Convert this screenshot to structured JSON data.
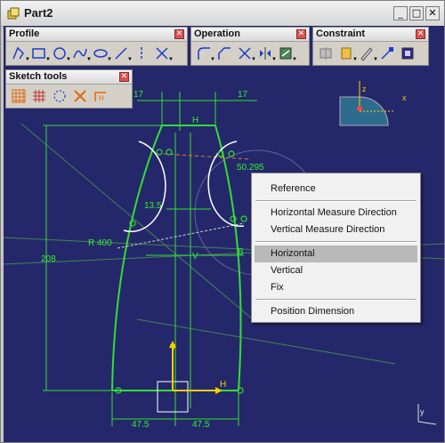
{
  "window": {
    "title": "Part2"
  },
  "toolbars": {
    "profile": {
      "title": "Profile"
    },
    "operation": {
      "title": "Operation"
    },
    "constraint": {
      "title": "Constraint"
    },
    "sketch_tools": {
      "title": "Sketch tools"
    }
  },
  "compass": {
    "axis_z": "z",
    "axis_x": "x"
  },
  "sketch": {
    "dimensions": {
      "top_left_width": "17",
      "top_right_width": "17",
      "top_label": "H",
      "angle": "50.295",
      "middle_width": "13.5",
      "radius": "R 400",
      "height": "208",
      "midline_label": "V",
      "right_label": "B",
      "bottom_left": "47.5",
      "bottom_right": "47.5"
    },
    "axis_v": "V",
    "axis_h": "H"
  },
  "context_menu": {
    "items": {
      "reference": "Reference",
      "horizontal_measure": "Horizontal Measure Direction",
      "vertical_measure": "Vertical Measure Direction",
      "horizontal": "Horizontal",
      "vertical": "Vertical",
      "fix": "Fix",
      "position_dimension": "Position Dimension"
    },
    "highlighted": "Horizontal"
  },
  "colors": {
    "background": "#24286a",
    "geometry": "#33dd33",
    "highlight": "#b9b9b9",
    "compass_bg": "#2f6b8c",
    "axis_yellow": "#f0d000"
  }
}
